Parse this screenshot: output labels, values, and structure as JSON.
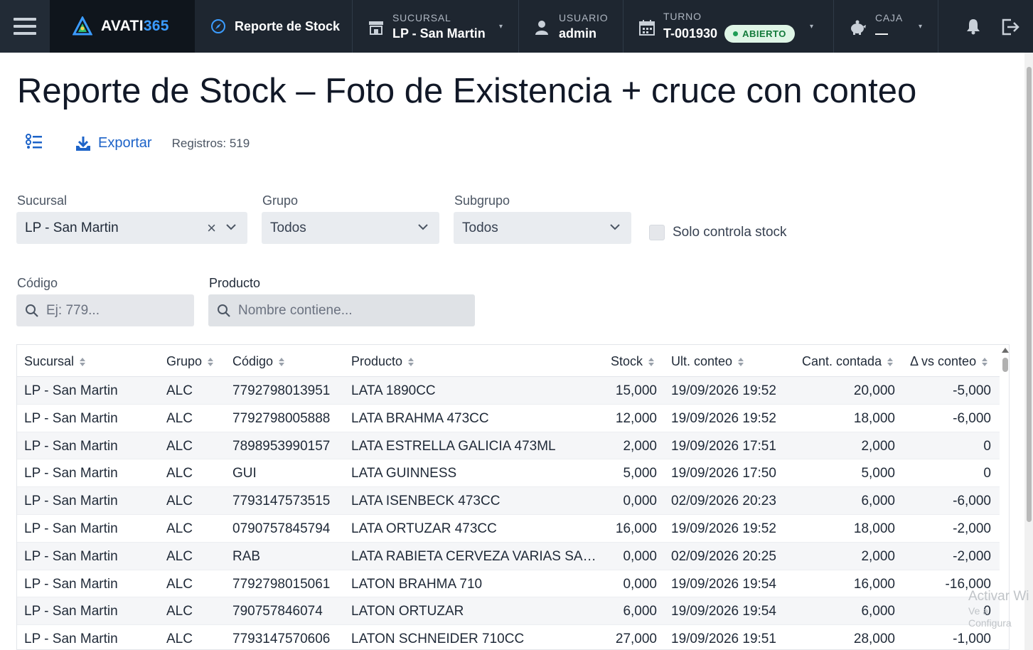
{
  "topbar": {
    "brand_name": "AVATI",
    "brand_suffix": "365",
    "module_title": "Reporte de Stock",
    "sucursal_label": "SUCURSAL",
    "sucursal_value": "LP - San Martin",
    "usuario_label": "USUARIO",
    "usuario_value": "admin",
    "turno_label": "TURNO",
    "turno_value": "T-001930",
    "turno_status": "ABIERTO",
    "caja_label": "CAJA",
    "caja_value": "—"
  },
  "page": {
    "title": "Reporte de Stock – Foto de Existencia + cruce con conteo",
    "export_label": "Exportar",
    "records_text": "Registros: 519"
  },
  "filters": {
    "sucursal_label": "Sucursal",
    "sucursal_value": "LP - San Martin",
    "grupo_label": "Grupo",
    "grupo_value": "Todos",
    "subgrupo_label": "Subgrupo",
    "subgrupo_value": "Todos",
    "solo_controla_label": "Solo controla stock",
    "codigo_label": "Código",
    "codigo_placeholder": "Ej: 779...",
    "producto_label": "Producto",
    "producto_placeholder": "Nombre contiene..."
  },
  "table": {
    "headers": [
      "Sucursal",
      "Grupo",
      "Código",
      "Producto",
      "Stock",
      "Ult. conteo",
      "Cant. contada",
      "Δ vs conteo"
    ],
    "rows": [
      [
        "LP - San Martin",
        "ALC",
        "7792798013951",
        "LATA 1890CC",
        "15,000",
        "19/09/2026 19:52",
        "20,000",
        "-5,000"
      ],
      [
        "LP - San Martin",
        "ALC",
        "7792798005888",
        "LATA BRAHMA 473CC",
        "12,000",
        "19/09/2026 19:52",
        "18,000",
        "-6,000"
      ],
      [
        "LP - San Martin",
        "ALC",
        "7898953990157",
        "LATA ESTRELLA GALICIA 473ML",
        "2,000",
        "19/09/2026 17:51",
        "2,000",
        "0"
      ],
      [
        "LP - San Martin",
        "ALC",
        "GUI",
        "LATA GUINNESS",
        "5,000",
        "19/09/2026 17:50",
        "5,000",
        "0"
      ],
      [
        "LP - San Martin",
        "ALC",
        "7793147573515",
        "LATA ISENBECK 473CC",
        "0,000",
        "02/09/2026 20:23",
        "6,000",
        "-6,000"
      ],
      [
        "LP - San Martin",
        "ALC",
        "0790757845794",
        "LATA ORTUZAR 473CC",
        "16,000",
        "19/09/2026 19:52",
        "18,000",
        "-2,000"
      ],
      [
        "LP - San Martin",
        "ALC",
        "RAB",
        "LATA RABIETA CERVEZA VARIAS SA…",
        "0,000",
        "02/09/2026 20:25",
        "2,000",
        "-2,000"
      ],
      [
        "LP - San Martin",
        "ALC",
        "7792798015061",
        "LATON BRAHMA 710",
        "0,000",
        "19/09/2026 19:54",
        "16,000",
        "-16,000"
      ],
      [
        "LP - San Martin",
        "ALC",
        "790757846074",
        "LATON ORTUZAR",
        "6,000",
        "19/09/2026 19:54",
        "6,000",
        "0"
      ],
      [
        "LP - San Martin",
        "ALC",
        "7793147570606",
        "LATON SCHNEIDER 710CC",
        "27,000",
        "19/09/2026 19:51",
        "28,000",
        "-1,000"
      ]
    ]
  },
  "watermark": {
    "line1": "Activar Wi",
    "line2": "Ve a Configura"
  },
  "colors": {
    "topbar_bg": "#1e2630",
    "brand_bg": "#0f151c",
    "accent_blue": "#1d63c8",
    "status_green": "#1f9d55"
  }
}
